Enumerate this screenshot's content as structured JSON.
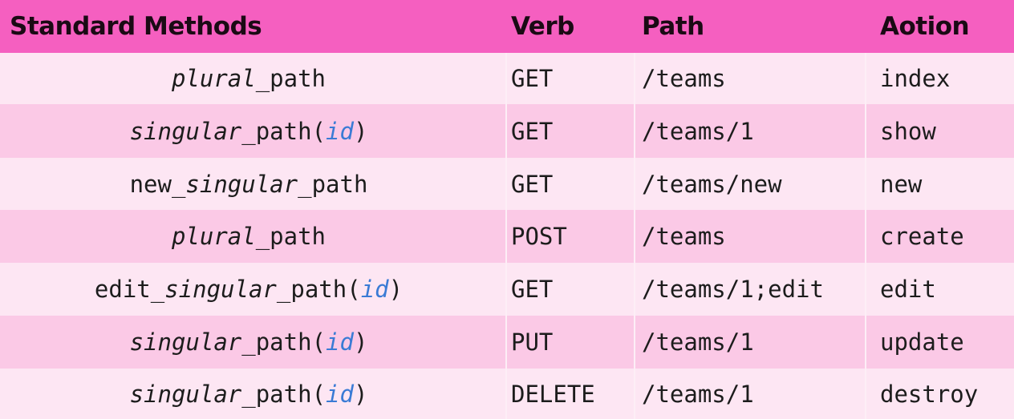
{
  "header": {
    "col1": "Standard Methods",
    "col2": "Verb",
    "col3": "Path",
    "col4": "Aotion"
  },
  "rows": [
    {
      "method": {
        "prefix": "",
        "italic": "plural",
        "suffix": "_path",
        "open": "",
        "param": "",
        "close": ""
      },
      "verb": "GET",
      "path": "/teams",
      "action": "index"
    },
    {
      "method": {
        "prefix": "",
        "italic": "singular",
        "suffix": "_path",
        "open": "(",
        "param": "id",
        "close": ")"
      },
      "verb": "GET",
      "path": "/teams/1",
      "action": "show"
    },
    {
      "method": {
        "prefix": "new_",
        "italic": "singular",
        "suffix": "_path",
        "open": "",
        "param": "",
        "close": ""
      },
      "verb": "GET",
      "path": "/teams/new",
      "action": "new"
    },
    {
      "method": {
        "prefix": "",
        "italic": "plural",
        "suffix": "_path",
        "open": "",
        "param": "",
        "close": ""
      },
      "verb": "POST",
      "path": "/teams",
      "action": "create"
    },
    {
      "method": {
        "prefix": "edit_",
        "italic": "singular",
        "suffix": "_path",
        "open": "(",
        "param": "id",
        "close": ")"
      },
      "verb": "GET",
      "path": "/teams/1;edit",
      "action": "edit"
    },
    {
      "method": {
        "prefix": "",
        "italic": "singular",
        "suffix": "_path",
        "open": "(",
        "param": "id",
        "close": ")"
      },
      "verb": "PUT",
      "path": "/teams/1",
      "action": "update"
    },
    {
      "method": {
        "prefix": "",
        "italic": "singular",
        "suffix": "_path",
        "open": "(",
        "param": "id",
        "close": ")"
      },
      "verb": "DELETE",
      "path": "/teams/1",
      "action": "destroy"
    }
  ]
}
